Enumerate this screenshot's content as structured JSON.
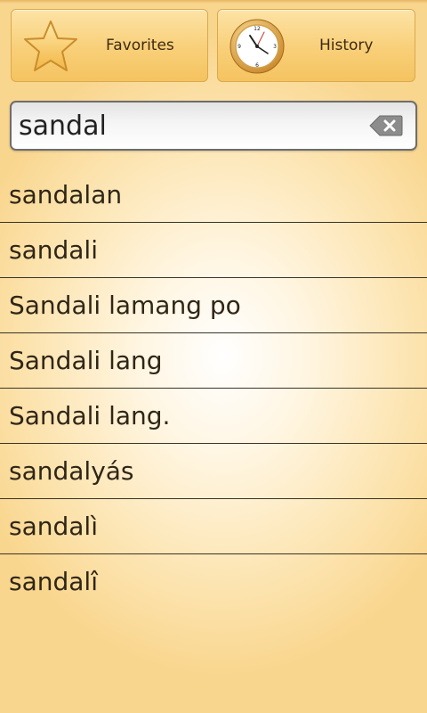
{
  "header": {
    "favorites": {
      "label": "Favorites",
      "icon": "star-icon"
    },
    "history": {
      "label": "History",
      "icon": "clock-icon"
    }
  },
  "search": {
    "value": "sandal",
    "clear_icon": "backspace-clear-icon"
  },
  "results": [
    "sandalan",
    "sandali",
    "Sandali lamang po",
    "Sandali lang",
    "Sandali lang.",
    "sandalyás",
    "sandalì",
    "sandalî"
  ],
  "colors": {
    "button_gold": "#f8cf78",
    "background_center": "#ffffff",
    "background_edge": "#f9d68e",
    "text": "#2f2617",
    "divider": "#3d3326"
  }
}
